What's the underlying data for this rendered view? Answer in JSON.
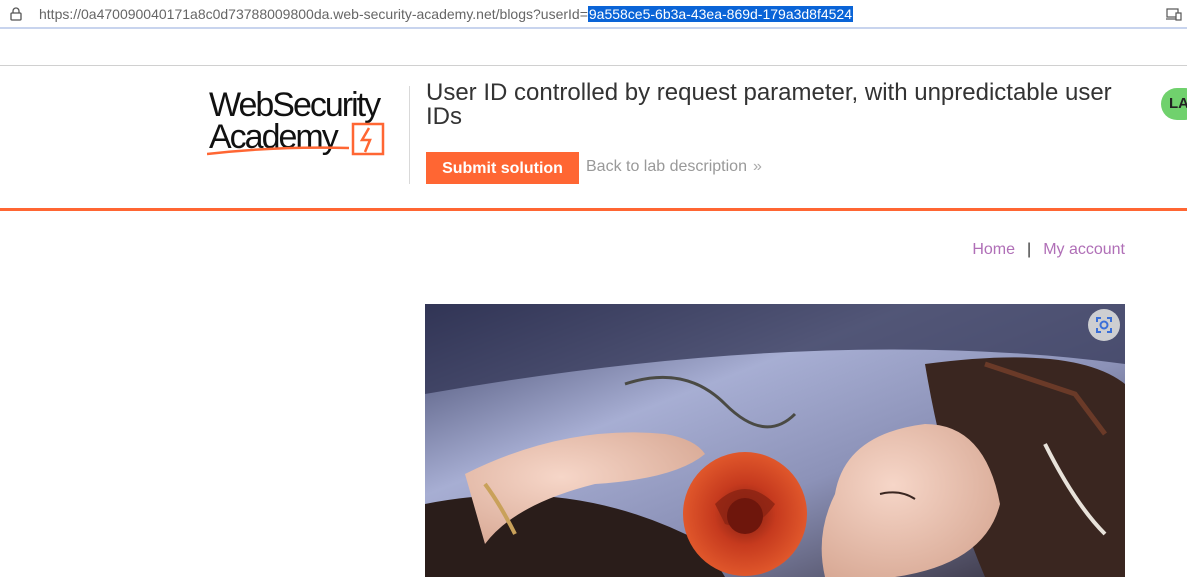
{
  "browser": {
    "url_prefix": "https://0a470090040171a8c0d73788009800da.web-security-academy.net/blogs?userId=",
    "url_selected": "9a558ce5-6b3a-43ea-869d-179a3d8f4524"
  },
  "header": {
    "logo_line1": "WebSecurity",
    "logo_line2": "Academy",
    "lab_title": "User ID controlled by request parameter, with unpredictable user IDs",
    "submit_label": "Submit solution",
    "back_label": "Back to lab description",
    "status_label": "LA",
    "accent_color": "#ff6633",
    "status_color": "#70d16d"
  },
  "nav": {
    "home_label": "Home",
    "separator": "|",
    "account_label": "My account",
    "link_color": "#b06fb7"
  },
  "blog": {
    "image_subject": "woman-with-red-rose"
  }
}
